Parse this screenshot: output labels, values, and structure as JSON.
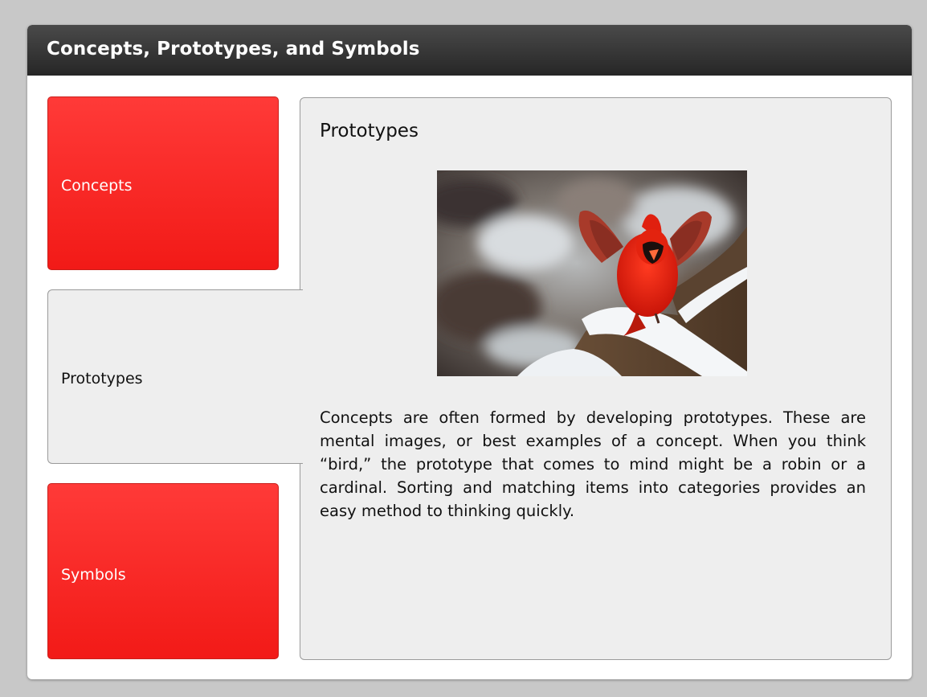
{
  "window": {
    "title": "Concepts, Prototypes, and Symbols"
  },
  "tabs": [
    {
      "label": "Concepts",
      "active": false
    },
    {
      "label": "Prototypes",
      "active": true
    },
    {
      "label": "Symbols",
      "active": false
    }
  ],
  "content": {
    "heading": "Prototypes",
    "image": {
      "icon": "cardinal-bird-photo"
    },
    "body": "Concepts are often formed by developing prototypes. These are mental images, or best examples of a concept. When you think “bird,” the prototype that comes to mind might be a robin or a cardinal. Sorting and matching items into categories provides an easy method to thinking quickly."
  },
  "colors": {
    "titlebar": "#333333",
    "tab_inactive": "#f52220",
    "panel": "#eeeeee",
    "page_background": "#c8c8c8"
  }
}
